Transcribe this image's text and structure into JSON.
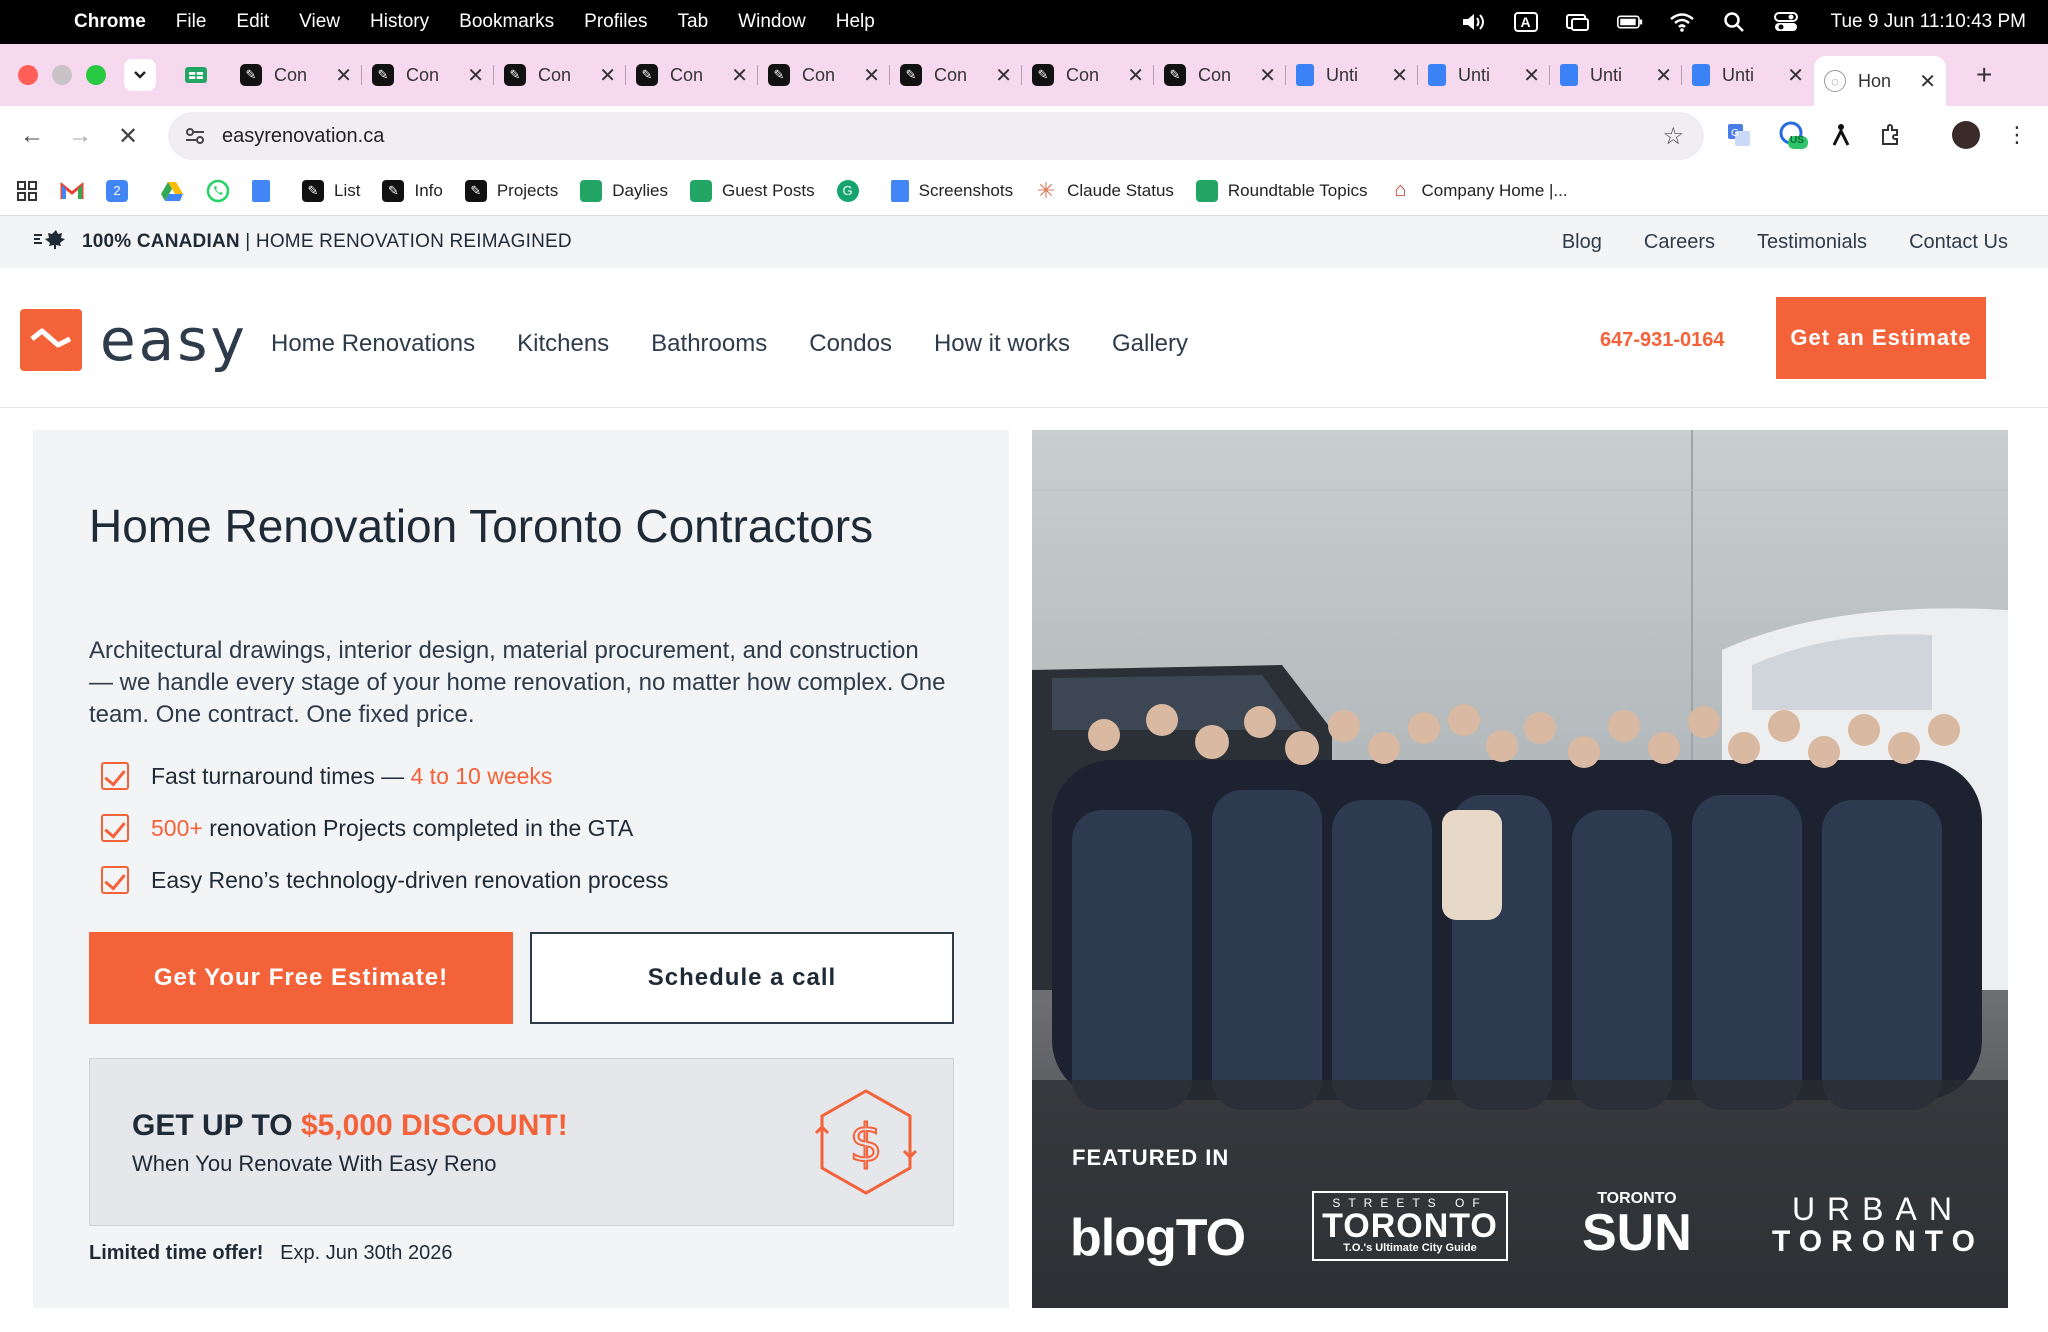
{
  "menubar": {
    "app": "Chrome",
    "items": [
      "File",
      "Edit",
      "View",
      "History",
      "Bookmarks",
      "Profiles",
      "Tab",
      "Window",
      "Help"
    ],
    "input_indicator": "A",
    "clock": "Tue 9 Jun  11:10:43 PM"
  },
  "tabs": [
    {
      "title": "Con",
      "icon": "pen-icon"
    },
    {
      "title": "Con",
      "icon": "pen-icon"
    },
    {
      "title": "Con",
      "icon": "pen-icon"
    },
    {
      "title": "Con",
      "icon": "pen-icon"
    },
    {
      "title": "Con",
      "icon": "pen-icon"
    },
    {
      "title": "Con",
      "icon": "pen-icon"
    },
    {
      "title": "Con",
      "icon": "pen-icon"
    },
    {
      "title": "Con",
      "icon": "pen-icon"
    },
    {
      "title": "Unti",
      "icon": "docs-icon"
    },
    {
      "title": "Unti",
      "icon": "docs-icon"
    },
    {
      "title": "Unti",
      "icon": "docs-icon"
    },
    {
      "title": "Unti",
      "icon": "docs-icon"
    }
  ],
  "active_tab": {
    "title": "Hon"
  },
  "omnibox": {
    "url": "easyrenovation.ca"
  },
  "extensions": {
    "badge": "US"
  },
  "bookmarks": [
    {
      "label": "",
      "icon": "apps-grid-icon"
    },
    {
      "label": "",
      "icon": "gmail-icon"
    },
    {
      "label": "",
      "icon": "calendar-icon"
    },
    {
      "label": "",
      "icon": "drive-icon"
    },
    {
      "label": "",
      "icon": "whatsapp-icon"
    },
    {
      "label": "",
      "icon": "docs-icon"
    },
    {
      "label": "List",
      "icon": "pen-icon"
    },
    {
      "label": "Info",
      "icon": "pen-icon"
    },
    {
      "label": "Projects",
      "icon": "pen-icon"
    },
    {
      "label": "Daylies",
      "icon": "sheets-icon"
    },
    {
      "label": "Guest Posts",
      "icon": "sheets-icon"
    },
    {
      "label": "",
      "icon": "grammarly-icon"
    },
    {
      "label": "Screenshots",
      "icon": "docs-icon"
    },
    {
      "label": "Claude Status",
      "icon": "claude-icon"
    },
    {
      "label": "Roundtable Topics",
      "icon": "sheets-icon"
    },
    {
      "label": "Company Home |...",
      "icon": "house-icon"
    }
  ],
  "site": {
    "topbar": {
      "slogan_bold": "100% CANADIAN",
      "slogan_rest": " | HOME RENOVATION REIMAGINED",
      "links": [
        "Blog",
        "Careers",
        "Testimonials",
        "Contact Us"
      ]
    },
    "nav": {
      "logo": "easy",
      "links": [
        "Home Renovations",
        "Kitchens",
        "Bathrooms",
        "Condos",
        "How it works",
        "Gallery"
      ],
      "phone": "647-931-0164",
      "cta": "Get an Estimate"
    },
    "hero": {
      "title": "Home Renovation Toronto Contractors",
      "description": "Architectural drawings, interior design, material procurement, and construction — we handle every stage of your home renovation, no matter how complex. One team. One contract. One fixed price.",
      "check1_text": "Fast turnaround times — ",
      "check1_accent": "4 to 10 weeks",
      "check2_accent": "500+",
      "check2_text": " renovation Projects completed in the GTA",
      "check3_text": "Easy Reno’s technology-driven renovation process",
      "cta_primary": "Get Your Free Estimate!",
      "cta_secondary": "Schedule a call",
      "promo_head": "GET UP TO ",
      "promo_amount": "$5,000 DISCOUNT!",
      "promo_sub": "When You Renovate With Easy Reno",
      "limited_bold": "Limited time offer!",
      "limited_exp": "Exp. Jun 30th 2026"
    },
    "featured": {
      "label": "FEATURED IN",
      "logos": [
        "blogTO",
        "STREETS OF",
        "TORONTO",
        "T.O.'s Ultimate City Guide",
        "TORONTO",
        "SUN",
        "URBAN",
        "TORONTO"
      ]
    }
  },
  "colors": {
    "accent": "#f4623a",
    "text": "#1f2a37",
    "tab_strip": "#f7d9ef"
  }
}
